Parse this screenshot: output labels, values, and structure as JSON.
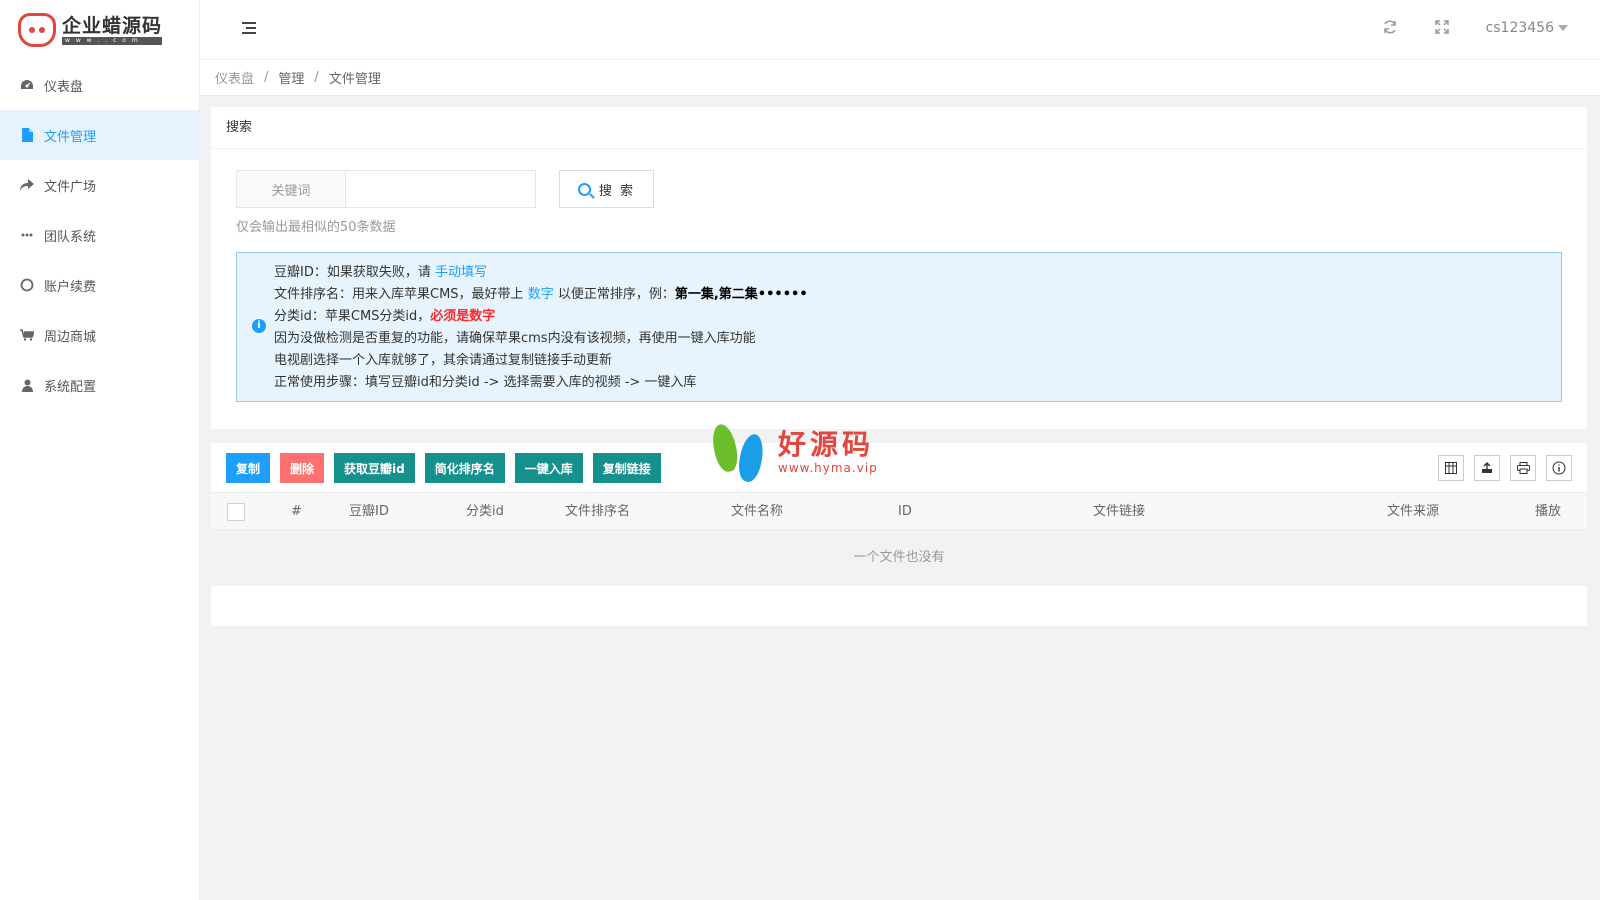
{
  "logo": {
    "title": "企业蜡源码",
    "subtitle": "w w w . . c o m"
  },
  "sidebar": {
    "items": [
      {
        "label": "仪表盘",
        "icon": "dashboard-icon"
      },
      {
        "label": "文件管理",
        "icon": "file-icon",
        "active": true
      },
      {
        "label": "文件广场",
        "icon": "share-icon"
      },
      {
        "label": "团队系统",
        "icon": "ellipsis-icon"
      },
      {
        "label": "账户续费",
        "icon": "circle-icon"
      },
      {
        "label": "周边商城",
        "icon": "cart-icon"
      },
      {
        "label": "系统配置",
        "icon": "user-icon"
      }
    ]
  },
  "header": {
    "username": "cs123456"
  },
  "breadcrumb": {
    "items": [
      "仪表盘",
      "管理",
      "文件管理"
    ]
  },
  "search": {
    "card_title": "搜索",
    "keyword_label": "关键词",
    "keyword_value": "",
    "button_label": "搜 索",
    "hint": "仅会输出最相似的50条数据"
  },
  "info": {
    "line1_prefix": "豆瓣ID：如果获取失败，请 ",
    "line1_link": "手动填写",
    "line2_prefix": "文件排序名：用来入库苹果CMS，最好带上 ",
    "line2_highlight": "数字",
    "line2_middle": " 以便正常排序，例：",
    "line2_bold": "第一集,第二集••••••",
    "line3_prefix": "分类id：苹果CMS分类id，",
    "line3_red": "必须是数字",
    "line4": "因为没做检测是否重复的功能，请确保苹果cms内没有该视频，再使用一键入库功能",
    "line5": "电视剧选择一个入库就够了，其余请通过复制链接手动更新",
    "line6": "正常使用步骤：填写豆瓣id和分类id -> 选择需要入库的视频 -> 一键入库"
  },
  "toolbar": {
    "copy": "复制",
    "delete": "删除",
    "get_douban": "获取豆瓣id",
    "simplify_sort": "简化排序名",
    "one_click_import": "一键入库",
    "copy_link": "复制链接"
  },
  "watermark": {
    "text": "好源码",
    "url": "www.hyma.vip"
  },
  "table": {
    "columns": [
      "#",
      "豆瓣ID",
      "分类id",
      "文件排序名",
      "文件名称",
      "ID",
      "文件链接",
      "文件来源",
      "播放"
    ],
    "empty_text": "一个文件也没有"
  },
  "colors": {
    "accent": "#1e9fff",
    "danger": "#ff7070",
    "success": "#16908c",
    "info_bg": "#e8f4fd"
  }
}
